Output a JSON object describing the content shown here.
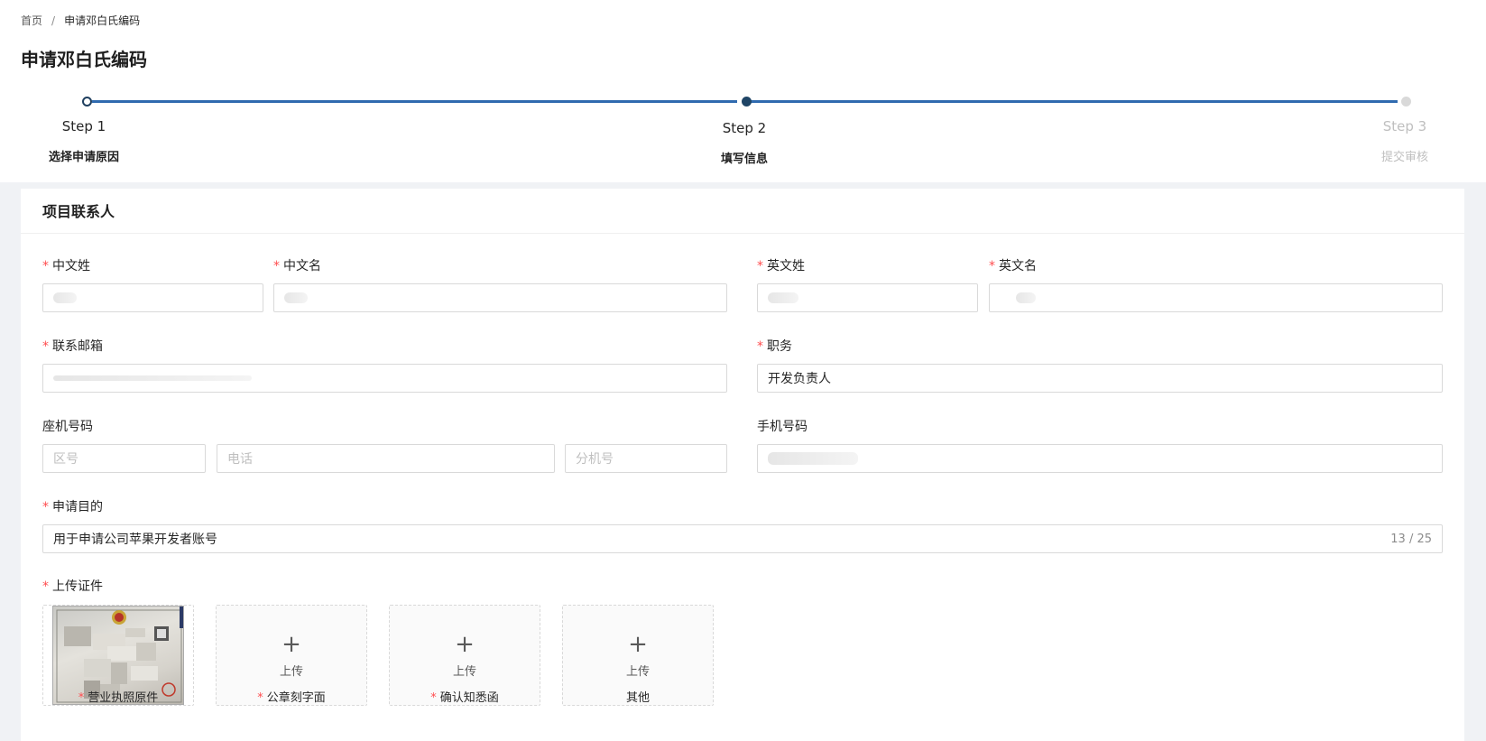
{
  "breadcrumb": {
    "home": "首页",
    "separator": "/",
    "current": "申请邓白氏编码"
  },
  "page_title": "申请邓白氏编码",
  "steps": [
    {
      "title": "Step 1",
      "description": "选择申请原因",
      "status": "finished"
    },
    {
      "title": "Step 2",
      "description": "填写信息",
      "status": "current"
    },
    {
      "title": "Step 3",
      "description": "提交审核",
      "status": "waiting"
    }
  ],
  "section": {
    "title": "项目联系人"
  },
  "fields": {
    "cn_surname": {
      "label": "中文姓",
      "required": true,
      "value": ""
    },
    "cn_given_name": {
      "label": "中文名",
      "required": true,
      "value": ""
    },
    "en_surname": {
      "label": "英文姓",
      "required": true,
      "value": ""
    },
    "en_given_name": {
      "label": "英文名",
      "required": true,
      "value": ""
    },
    "email": {
      "label": "联系邮箱",
      "required": true,
      "value": ""
    },
    "position": {
      "label": "职务",
      "required": true,
      "value": "开发负责人"
    },
    "landline": {
      "label": "座机号码",
      "required": false,
      "area_placeholder": "区号",
      "phone_placeholder": "电话",
      "ext_placeholder": "分机号"
    },
    "mobile": {
      "label": "手机号码",
      "required": false,
      "value": ""
    },
    "purpose": {
      "label": "申请目的",
      "required": true,
      "value": "用于申请公司苹果开发者账号",
      "count": "13 / 25"
    },
    "upload": {
      "label": "上传证件",
      "required": true
    }
  },
  "uploads": [
    {
      "caption": "营业执照原件",
      "required": true,
      "filled": true
    },
    {
      "caption": "公章刻字面",
      "required": true,
      "filled": false,
      "button_label": "上传"
    },
    {
      "caption": "确认知悉函",
      "required": true,
      "filled": false,
      "button_label": "上传"
    },
    {
      "caption": "其他",
      "required": false,
      "filled": false,
      "button_label": "上传"
    }
  ],
  "colors": {
    "primary_line": "#2f6aaf",
    "required_mark": "#ff4d4f",
    "step_current": "#1f4566"
  }
}
